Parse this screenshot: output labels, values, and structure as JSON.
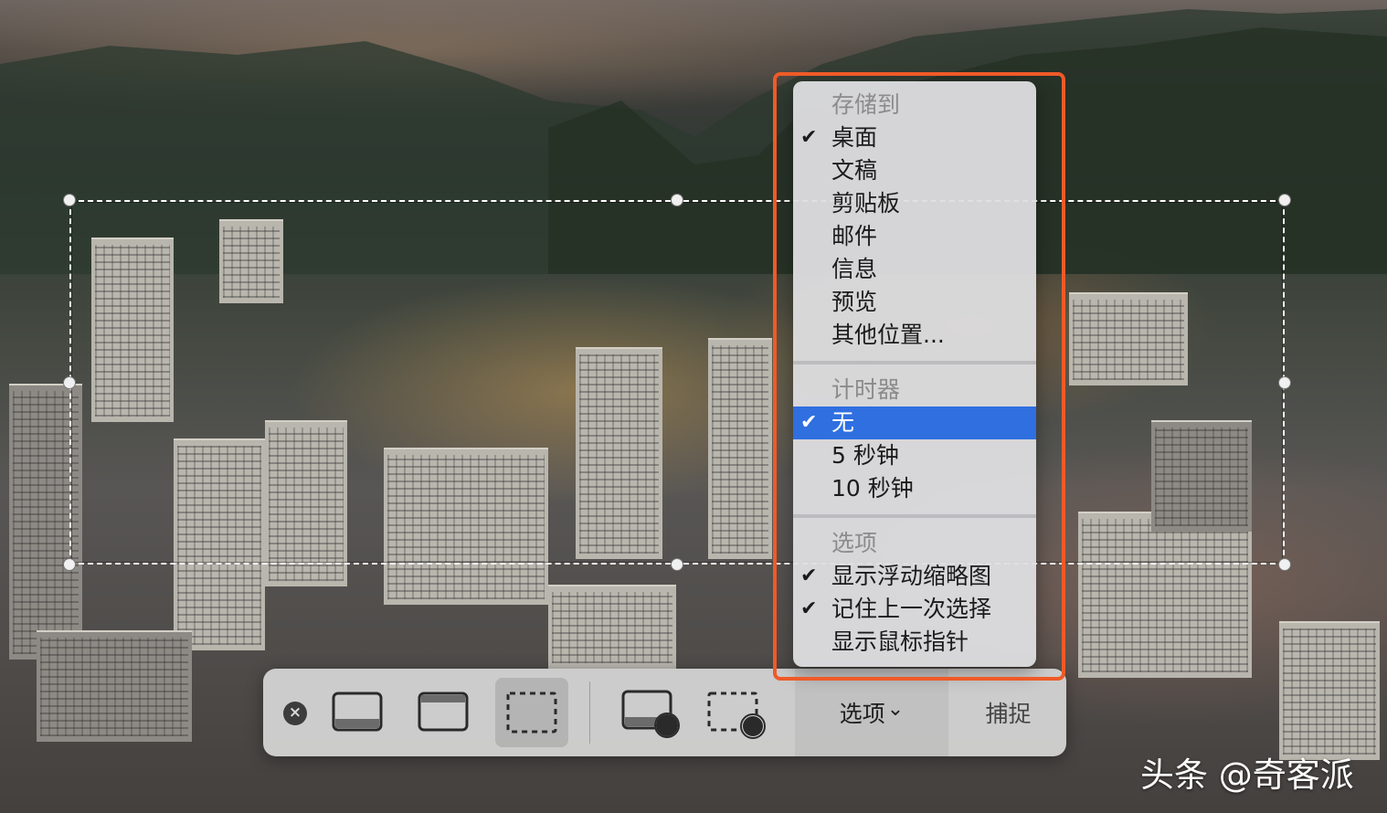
{
  "toolbar": {
    "close_icon": "close-icon",
    "capture_screen_icon": "display-icon",
    "capture_window_icon": "window-icon",
    "capture_selection_icon": "dashed-rect-icon",
    "record_screen_icon": "display-record-icon",
    "record_selection_icon": "dashed-rect-record-icon",
    "options_label": "选项",
    "options_chevron": "⌄",
    "capture_label": "捕捉"
  },
  "menu": {
    "save_to": {
      "header": "存储到",
      "items": [
        {
          "label": "桌面",
          "checked": true
        },
        {
          "label": "文稿",
          "checked": false
        },
        {
          "label": "剪贴板",
          "checked": false
        },
        {
          "label": "邮件",
          "checked": false
        },
        {
          "label": "信息",
          "checked": false
        },
        {
          "label": "预览",
          "checked": false
        },
        {
          "label": "其他位置...",
          "checked": false
        }
      ]
    },
    "timer": {
      "header": "计时器",
      "items": [
        {
          "label": "无",
          "checked": true,
          "selected": true
        },
        {
          "label": "5 秒钟",
          "checked": false
        },
        {
          "label": "10 秒钟",
          "checked": false
        }
      ]
    },
    "options": {
      "header": "选项",
      "items": [
        {
          "label": "显示浮动缩略图",
          "checked": true
        },
        {
          "label": "记住上一次选择",
          "checked": true
        },
        {
          "label": "显示鼠标指针",
          "checked": false
        }
      ]
    },
    "check_glyph": "✔"
  },
  "watermark": "头条 @奇客派",
  "colors": {
    "highlight": "#ef5a28",
    "selected_row": "#2f6fe0"
  }
}
